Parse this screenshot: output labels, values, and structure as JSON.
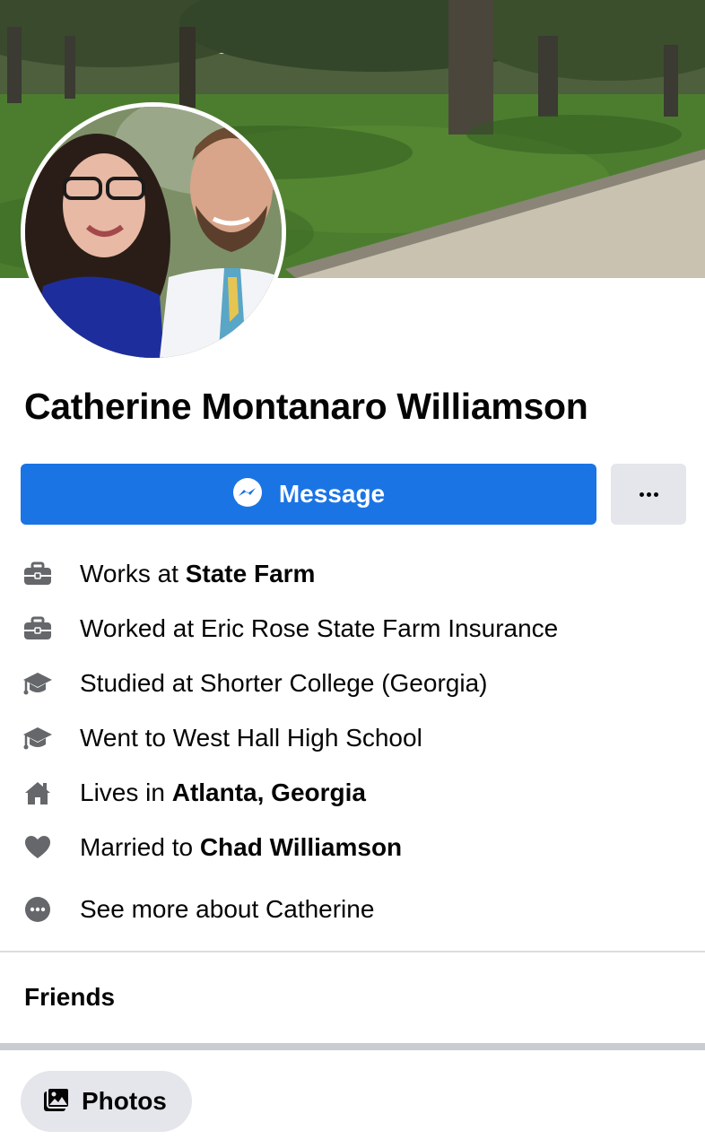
{
  "profile": {
    "name": "Catherine Montanaro Williamson"
  },
  "actions": {
    "message_label": "Message",
    "more_label": "More options"
  },
  "intro": [
    {
      "icon": "briefcase-icon",
      "prefix": "Works at ",
      "bold": "State Farm"
    },
    {
      "icon": "briefcase-icon",
      "prefix": "Worked at Eric Rose State Farm Insurance",
      "bold": ""
    },
    {
      "icon": "graduation-cap-icon",
      "prefix": "Studied at Shorter College (Georgia)",
      "bold": ""
    },
    {
      "icon": "graduation-cap-icon",
      "prefix": "Went to West Hall High School",
      "bold": ""
    },
    {
      "icon": "home-icon",
      "prefix": "Lives in ",
      "bold": "Atlanta, Georgia"
    },
    {
      "icon": "heart-icon",
      "prefix": "Married to ",
      "bold": "Chad Williamson"
    },
    {
      "icon": "more-dots-icon",
      "prefix": "See more about Catherine",
      "bold": ""
    }
  ],
  "sections": {
    "friends_label": "Friends",
    "photos_label": "Photos"
  },
  "colors": {
    "primary": "#1b74e4",
    "secondary_button": "#e4e6eb",
    "icon_gray": "#65676b",
    "divider": "#dadde1"
  }
}
